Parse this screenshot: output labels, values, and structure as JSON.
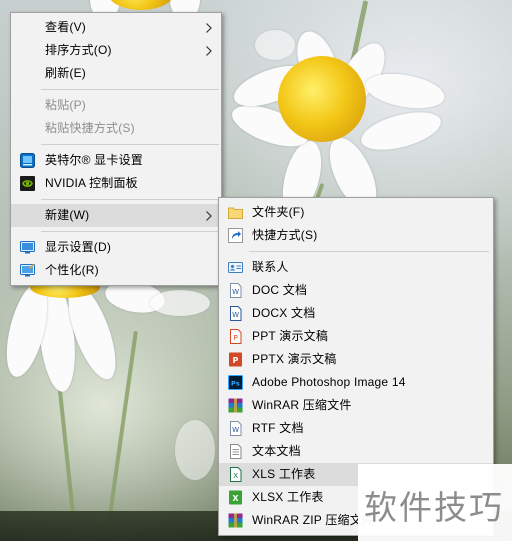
{
  "main_menu": {
    "items": [
      {
        "label": "查看(V)"
      },
      {
        "label": "排序方式(O)"
      },
      {
        "label": "刷新(E)"
      },
      {
        "label": "粘贴(P)"
      },
      {
        "label": "粘贴快捷方式(S)"
      },
      {
        "label": "英特尔® 显卡设置"
      },
      {
        "label": "NVIDIA 控制面板"
      },
      {
        "label": "新建(W)"
      },
      {
        "label": "显示设置(D)"
      },
      {
        "label": "个性化(R)"
      }
    ]
  },
  "new_submenu": {
    "items": [
      {
        "label": "文件夹(F)"
      },
      {
        "label": "快捷方式(S)"
      },
      {
        "label": "联系人"
      },
      {
        "label": "DOC 文档",
        "icon_text": "W"
      },
      {
        "label": "DOCX 文档",
        "icon_text": "W"
      },
      {
        "label": "PPT 演示文稿",
        "icon_text": "P"
      },
      {
        "label": "PPTX 演示文稿",
        "icon_text": "P"
      },
      {
        "label": "Adobe Photoshop Image 14",
        "icon_text": "Ps"
      },
      {
        "label": "WinRAR 压缩文件"
      },
      {
        "label": "RTF 文档",
        "icon_text": "W"
      },
      {
        "label": "文本文档"
      },
      {
        "label": "XLS 工作表",
        "icon_text": "X"
      },
      {
        "label": "XLSX 工作表",
        "icon_text": "X"
      },
      {
        "label": "WinRAR ZIP 压缩文件"
      }
    ]
  },
  "watermark": {
    "text": "软件技巧"
  },
  "colors": {
    "menu_bg": "#f2f2f2",
    "highlight": "#dcdcdc",
    "disabled_text": "#8e8e8e",
    "word_blue": "#2b579a",
    "ppt_orange": "#d24726",
    "excel_green": "#217346",
    "nvidia_green": "#76b900",
    "folder_yellow": "#f8d775"
  }
}
